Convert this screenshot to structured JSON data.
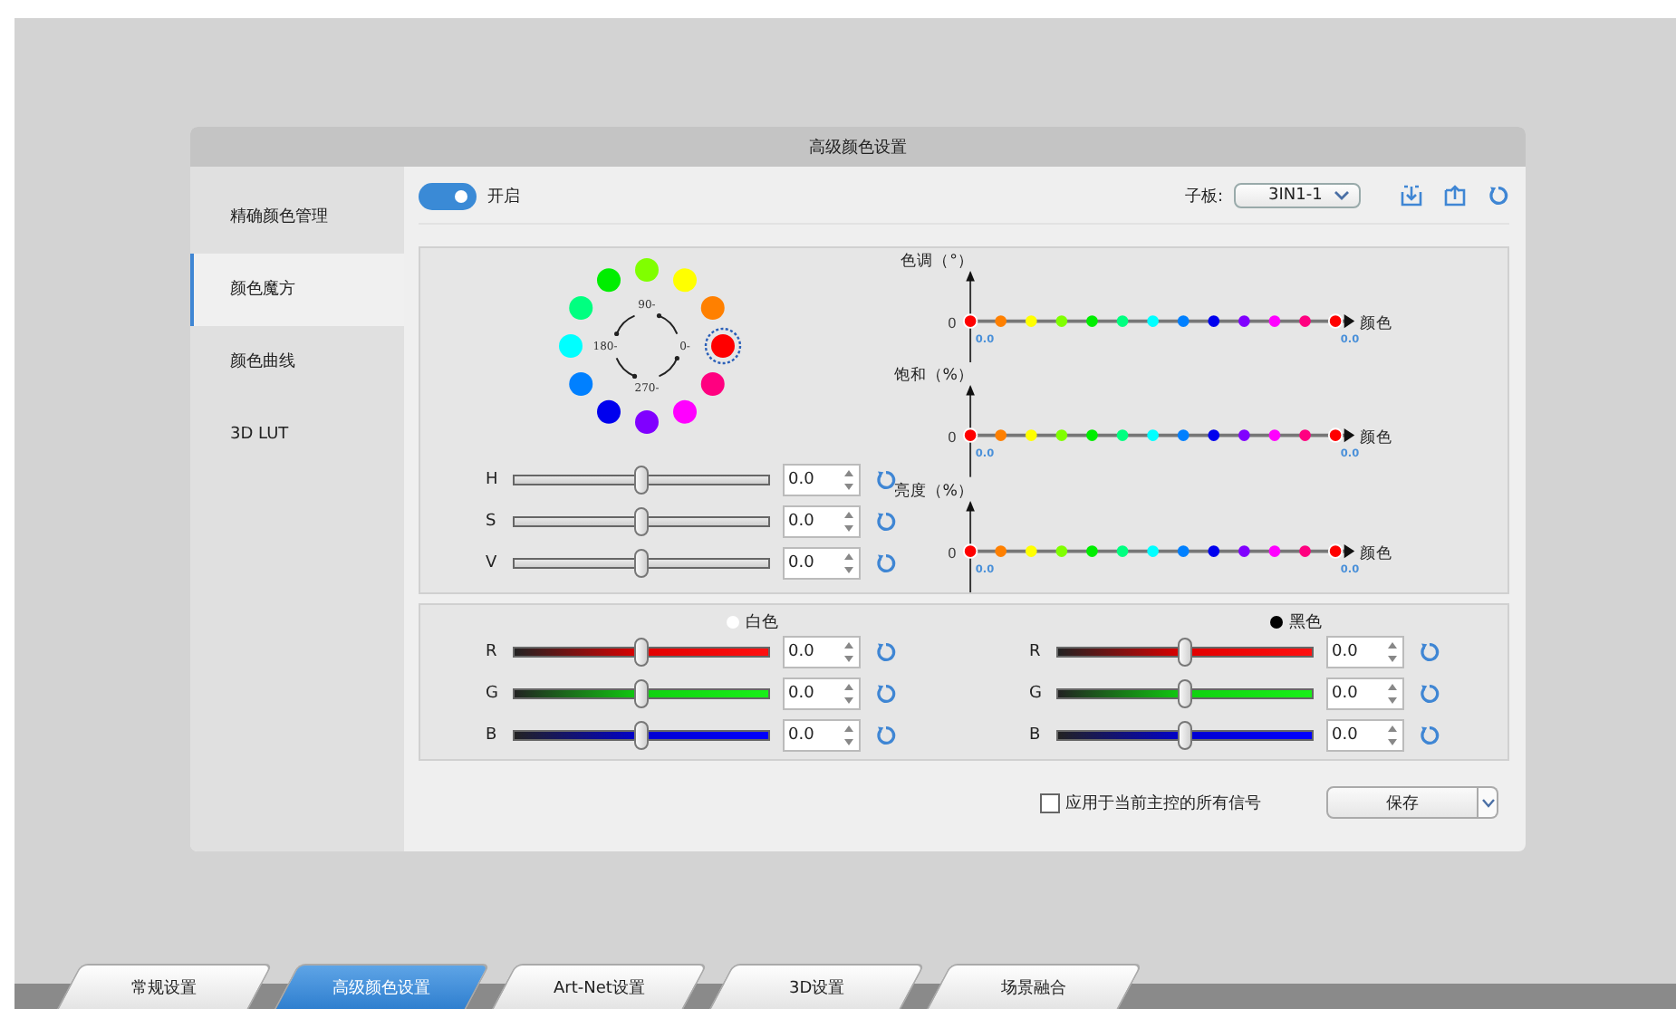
{
  "dialog": {
    "title": "高级颜色设置"
  },
  "sidebar": {
    "items": [
      {
        "label": "精确颜色管理",
        "selected": false
      },
      {
        "label": "颜色魔方",
        "selected": true
      },
      {
        "label": "颜色曲线",
        "selected": false
      },
      {
        "label": "3D LUT",
        "selected": false
      }
    ]
  },
  "toolbar": {
    "toggle": {
      "label": "开启",
      "on": true
    },
    "board_label": "子板:",
    "board_select": {
      "value": "3IN1-1"
    }
  },
  "wheel": {
    "angle_labels": [
      "90-",
      "180-",
      "0-",
      "270-"
    ],
    "colors": [
      {
        "color": "#ff0000",
        "selected": true
      },
      {
        "color": "#ff8000",
        "selected": false
      },
      {
        "color": "#ffff00",
        "selected": false
      },
      {
        "color": "#80ff00",
        "selected": false
      },
      {
        "color": "#00ee00",
        "selected": false
      },
      {
        "color": "#00ff80",
        "selected": false
      },
      {
        "color": "#00ffff",
        "selected": false
      },
      {
        "color": "#0080ff",
        "selected": false
      },
      {
        "color": "#0000ee",
        "selected": false
      },
      {
        "color": "#8000ff",
        "selected": false
      },
      {
        "color": "#ff00ff",
        "selected": false
      },
      {
        "color": "#ff0080",
        "selected": false
      }
    ]
  },
  "hsv_sliders": [
    {
      "label": "H",
      "level": 0.5,
      "value": "0.0"
    },
    {
      "label": "S",
      "level": 0.5,
      "value": "0.0"
    },
    {
      "label": "V",
      "level": 0.5,
      "value": "0.0"
    }
  ],
  "curves": {
    "points": [
      {
        "color": "#ff0000"
      },
      {
        "color": "#ff8000"
      },
      {
        "color": "#ffff00"
      },
      {
        "color": "#80ff00"
      },
      {
        "color": "#00ee00"
      },
      {
        "color": "#00ff80"
      },
      {
        "color": "#00ffff"
      },
      {
        "color": "#0080ff"
      },
      {
        "color": "#0000ee"
      },
      {
        "color": "#8000ff"
      },
      {
        "color": "#ff00ff"
      },
      {
        "color": "#ff0080"
      },
      {
        "color": "#ff0000"
      }
    ],
    "items": [
      {
        "title": "色调（°）",
        "zero": "0",
        "axis_label": "颜色",
        "start_value": "0.0",
        "end_value": "0.0"
      },
      {
        "title": "饱和（%）",
        "zero": "0",
        "axis_label": "颜色",
        "start_value": "0.0",
        "end_value": "0.0"
      },
      {
        "title": "亮度（%）",
        "zero": "0",
        "axis_label": "颜色",
        "start_value": "0.0",
        "end_value": "0.0"
      }
    ]
  },
  "balance": [
    {
      "label": "白色",
      "kind": "white",
      "sliders": [
        {
          "label": "R",
          "kind": "red",
          "level": 0.5,
          "value": "0.0"
        },
        {
          "label": "G",
          "kind": "green",
          "level": 0.5,
          "value": "0.0"
        },
        {
          "label": "B",
          "kind": "blue",
          "level": 0.5,
          "value": "0.0"
        }
      ]
    },
    {
      "label": "黑色",
      "kind": "black",
      "sliders": [
        {
          "label": "R",
          "kind": "red",
          "level": 0.5,
          "value": "0.0"
        },
        {
          "label": "G",
          "kind": "green",
          "level": 0.5,
          "value": "0.0"
        },
        {
          "label": "B",
          "kind": "blue",
          "level": 0.5,
          "value": "0.0"
        }
      ]
    }
  ],
  "apply_all": {
    "label": "应用于当前主控的所有信号",
    "checked": false
  },
  "save_button": {
    "label": "保存"
  },
  "bottom_tabs": [
    {
      "label": "常规设置",
      "selected": false
    },
    {
      "label": "高级颜色设置",
      "selected": true
    },
    {
      "label": "Art-Net设置",
      "selected": false
    },
    {
      "label": "3D设置",
      "selected": false
    },
    {
      "label": "场景融合",
      "selected": false
    }
  ]
}
